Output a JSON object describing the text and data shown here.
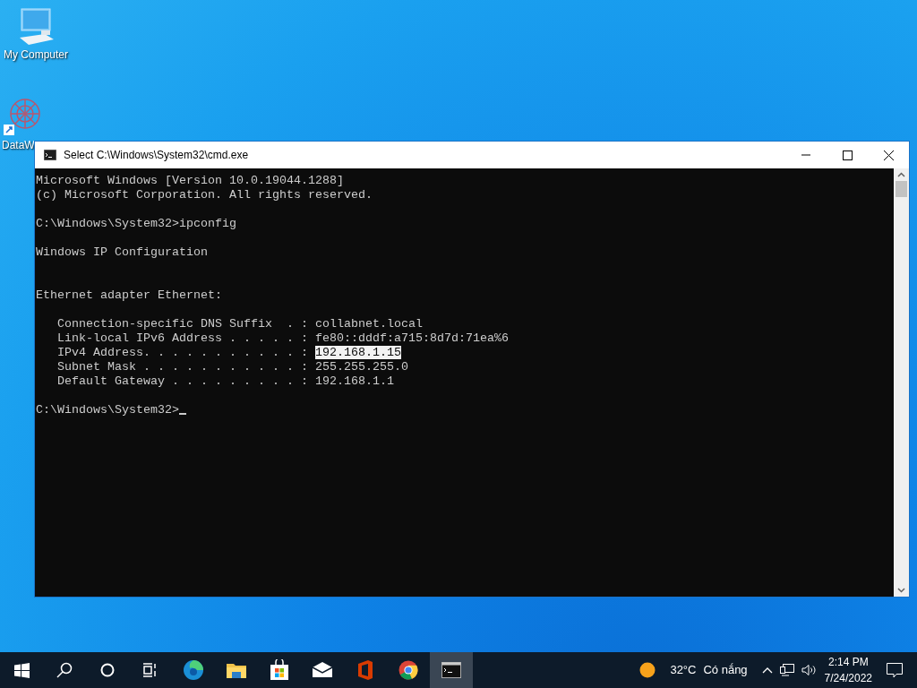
{
  "desktop_icons": [
    {
      "kind": "computer",
      "label": "My Computer"
    },
    {
      "kind": "app",
      "label": "DataW"
    }
  ],
  "window": {
    "title": "Select C:\\Windows\\System32\\cmd.exe",
    "lines": [
      {
        "kind": "text",
        "text": "Microsoft Windows [Version 10.0.19044.1288]"
      },
      {
        "kind": "text",
        "text": "(c) Microsoft Corporation. All rights reserved."
      },
      {
        "kind": "blank"
      },
      {
        "kind": "text",
        "text": "C:\\Windows\\System32>ipconfig"
      },
      {
        "kind": "blank"
      },
      {
        "kind": "text",
        "text": "Windows IP Configuration"
      },
      {
        "kind": "blank"
      },
      {
        "kind": "blank"
      },
      {
        "kind": "text",
        "text": "Ethernet adapter Ethernet:"
      },
      {
        "kind": "blank"
      },
      {
        "kind": "text",
        "text": "   Connection-specific DNS Suffix  . : collabnet.local"
      },
      {
        "kind": "text",
        "text": "   Link-local IPv6 Address . . . . . : fe80::dddf:a715:8d7d:71ea%6"
      },
      {
        "kind": "selection",
        "text": "   IPv4 Address. . . . . . . . . . . : ",
        "selected_text": "192.168.1.15"
      },
      {
        "kind": "text",
        "text": "   Subnet Mask . . . . . . . . . . . : 255.255.255.0"
      },
      {
        "kind": "text",
        "text": "   Default Gateway . . . . . . . . . : 192.168.1.1"
      },
      {
        "kind": "blank"
      },
      {
        "kind": "prompt",
        "text": "C:\\Windows\\System32>",
        "cursor": true
      }
    ]
  },
  "taskbar": {
    "apps": [
      {
        "kind": "start",
        "selected": false
      },
      {
        "kind": "search",
        "selected": false
      },
      {
        "kind": "cortana",
        "selected": false
      },
      {
        "kind": "taskview",
        "selected": false
      },
      {
        "kind": "edge",
        "selected": false
      },
      {
        "kind": "folder",
        "selected": false
      },
      {
        "kind": "store",
        "selected": false
      },
      {
        "kind": "mail",
        "selected": false
      },
      {
        "kind": "office",
        "selected": false
      },
      {
        "kind": "chrome",
        "selected": false
      },
      {
        "kind": "terminal",
        "selected": true
      }
    ],
    "weather": {
      "temperature": "32°C",
      "condition": "Có nắng"
    },
    "time": "2:14 PM",
    "date": "7/24/2022"
  }
}
